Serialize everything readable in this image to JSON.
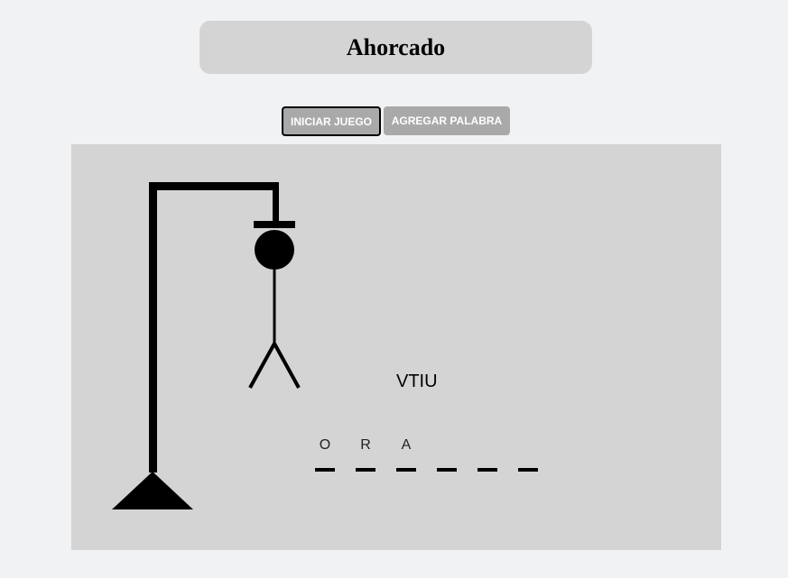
{
  "header": {
    "title": "Ahorcado"
  },
  "toolbar": {
    "start_label": "INICIAR JUEGO",
    "add_word_label": "AGREGAR PALABRA"
  },
  "game": {
    "wrong_letters": "VTIU",
    "word_slots": [
      "O",
      "R",
      "A",
      "",
      "",
      ""
    ]
  },
  "colors": {
    "background": "#f1f2f4",
    "panel": "#d4d4d4",
    "button": "#a9a9a9",
    "ink": "#000000"
  }
}
